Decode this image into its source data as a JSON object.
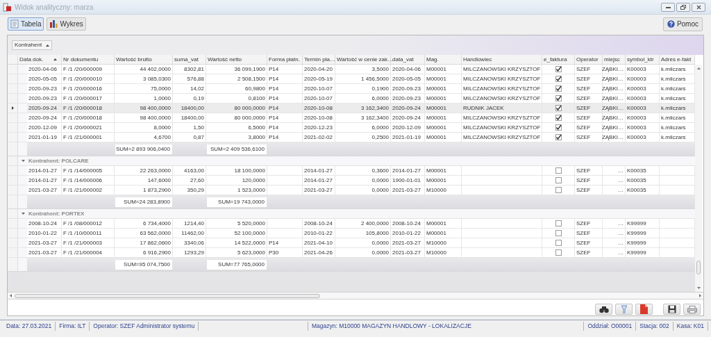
{
  "window": {
    "title": "Widok analityczny: marza"
  },
  "toolbar": {
    "tabs": [
      {
        "label": "Tabela",
        "selected": true,
        "kind": "table"
      },
      {
        "label": "Wykres",
        "selected": false,
        "kind": "chart"
      }
    ],
    "help": "Pomoc"
  },
  "group_panel": {
    "chip": "Kontrahent"
  },
  "columns": [
    {
      "label": "Data dok.",
      "sorted": true
    },
    {
      "label": "Nr dokumentu",
      "sorted": false
    },
    {
      "label": "Wartość brutto",
      "sorted": false
    },
    {
      "label": "suma_vat",
      "sorted": false
    },
    {
      "label": "Wartość netto",
      "sorted": false
    },
    {
      "label": "Forma płatn.",
      "sorted": false
    },
    {
      "label": "Termin pła…",
      "sorted": false
    },
    {
      "label": "Wartość w cenie zak…",
      "sorted": false
    },
    {
      "label": "data_vat",
      "sorted": false
    },
    {
      "label": "Mag.",
      "sorted": false
    },
    {
      "label": "Handlowiec",
      "sorted": false
    },
    {
      "label": "e_faktura",
      "sorted": false
    },
    {
      "label": "Operator",
      "sorted": false
    },
    {
      "label": "miejsc",
      "sorted": false
    },
    {
      "label": "symbol_ktr",
      "sorted": false
    },
    {
      "label": "Adres e-fakt",
      "sorted": false
    }
  ],
  "groups": [
    {
      "rows": [
        {
          "selected": false,
          "date": "2020-04-06",
          "doc": "F /1  /20/000009",
          "gross": "44 402,0000",
          "vat": "8302,81",
          "net": "36 099,1900",
          "payment": "P14",
          "due": "2020-04-20",
          "purchase": "3,5000",
          "vat_date": "2020-04-06",
          "warehouse": "M00001",
          "salesperson": "MILCZANOWSKI KRZYSZTOF",
          "e_invoice": true,
          "operator": "SZEF",
          "place": "ZĄBKI…",
          "symbol": "K00003",
          "email": "k.milczars"
        },
        {
          "selected": false,
          "date": "2020-05-05",
          "doc": "F /1  /20/000010",
          "gross": "3 085,0300",
          "vat": "576,88",
          "net": "2 508,1500",
          "payment": "P14",
          "due": "2020-05-19",
          "purchase": "1 456,5000",
          "vat_date": "2020-05-05",
          "warehouse": "M00001",
          "salesperson": "MILCZANOWSKI KRZYSZTOF",
          "e_invoice": true,
          "operator": "SZEF",
          "place": "ZĄBKI…",
          "symbol": "K00003",
          "email": "k.milczars"
        },
        {
          "selected": false,
          "date": "2020-09-23",
          "doc": "F /1  /20/000016",
          "gross": "75,0000",
          "vat": "14,02",
          "net": "60,9800",
          "payment": "P14",
          "due": "2020-10-07",
          "purchase": "0,1900",
          "vat_date": "2020-09-23",
          "warehouse": "M00001",
          "salesperson": "MILCZANOWSKI KRZYSZTOF",
          "e_invoice": true,
          "operator": "SZEF",
          "place": "ZĄBKI…",
          "symbol": "K00003",
          "email": "k.milczars"
        },
        {
          "selected": false,
          "date": "2020-09-23",
          "doc": "F /1  /20/000017",
          "gross": "1,0000",
          "vat": "0,19",
          "net": "0,8100",
          "payment": "P14",
          "due": "2020-10-07",
          "purchase": "6,0000",
          "vat_date": "2020-09-23",
          "warehouse": "M00001",
          "salesperson": "MILCZANOWSKI KRZYSZTOF",
          "e_invoice": true,
          "operator": "SZEF",
          "place": "ZĄBKI…",
          "symbol": "K00003",
          "email": "k.milczars"
        },
        {
          "selected": true,
          "date": "2020-09-24",
          "doc": "F /1  /20/000018",
          "gross": "98 400,0000",
          "vat": "18400,00",
          "net": "80 000,0000",
          "payment": "P14",
          "due": "2020-10-08",
          "purchase": "3 162,3400",
          "vat_date": "2020-09-24",
          "warehouse": "M00001",
          "salesperson": "RUDNIK JACEK",
          "e_invoice": true,
          "operator": "SZEF",
          "place": "ZĄBKI…",
          "symbol": "K00003",
          "email": "k.milczars"
        },
        {
          "selected": false,
          "date": "2020-09-24",
          "doc": "F /1  /20/000018",
          "gross": "98 400,0000",
          "vat": "18400,00",
          "net": "80 000,0000",
          "payment": "P14",
          "due": "2020-10-08",
          "purchase": "3 162,3400",
          "vat_date": "2020-09-24",
          "warehouse": "M00001",
          "salesperson": "MILCZANOWSKI KRZYSZTOF",
          "e_invoice": true,
          "operator": "SZEF",
          "place": "ZĄBKI…",
          "symbol": "K00003",
          "email": "k.milczars"
        },
        {
          "selected": false,
          "date": "2020-12-09",
          "doc": "F /1  /20/000021",
          "gross": "8,0000",
          "vat": "1,50",
          "net": "6,5000",
          "payment": "P14",
          "due": "2020-12-23",
          "purchase": "6,0000",
          "vat_date": "2020-12-09",
          "warehouse": "M00001",
          "salesperson": "MILCZANOWSKI KRZYSZTOF",
          "e_invoice": true,
          "operator": "SZEF",
          "place": "ZĄBKI…",
          "symbol": "K00003",
          "email": "k.milczars"
        },
        {
          "selected": false,
          "date": "2021-01-19",
          "doc": "F /1  /21/000001",
          "gross": "4,6700",
          "vat": "0,87",
          "net": "3,8000",
          "payment": "P14",
          "due": "2021-02-02",
          "purchase": "0,2500",
          "vat_date": "2021-01-19",
          "warehouse": "M00001",
          "salesperson": "MILCZANOWSKI KRZYSZTOF",
          "e_invoice": true,
          "operator": "SZEF",
          "place": "ZĄBKI…",
          "symbol": "K00003",
          "email": "k.milczars"
        }
      ],
      "sums": {
        "gross": "SUM=2 893 906,0400",
        "net": "SUM=2 409 536,6100"
      }
    },
    {
      "header": "Kontrahent: POLCARE",
      "expanded": true,
      "rows": [
        {
          "selected": false,
          "date": "2014-01-27",
          "doc": "F /1  /14/000005",
          "gross": "22 263,0000",
          "vat": "4163,00",
          "net": "18 100,0000",
          "due": "2014-01-27",
          "purchase": "0,3600",
          "vat_date": "2014-01-27",
          "warehouse": "M00001",
          "e_invoice": false,
          "operator": "SZEF",
          "place": "…",
          "symbol": "K00035"
        },
        {
          "selected": false,
          "date": "2014-01-27",
          "doc": "F /1  /14/000006",
          "gross": "147,6000",
          "vat": "27,60",
          "net": "120,0000",
          "due": "2014-01-27",
          "purchase": "0,0000",
          "vat_date": "1900-01-01",
          "warehouse": "M00001",
          "e_invoice": false,
          "operator": "SZEF",
          "place": "…",
          "symbol": "K00035"
        },
        {
          "selected": false,
          "date": "2021-03-27",
          "doc": "F /1  /21/000002",
          "gross": "1 873,2900",
          "vat": "350,29",
          "net": "1 523,0000",
          "due": "2021-03-27",
          "purchase": "0,0000",
          "vat_date": "2021-03-27",
          "warehouse": "M10000",
          "e_invoice": false,
          "operator": "SZEF",
          "place": "…",
          "symbol": "K00035"
        }
      ],
      "sums": {
        "gross": "SUM=24 283,8900",
        "net": "SUM=19 743,0000"
      }
    },
    {
      "header": "Kontrahent: PORTEX",
      "expanded": true,
      "rows": [
        {
          "selected": false,
          "date": "2008-10-24",
          "doc": "F /1  /08/000012",
          "gross": "6 734,4000",
          "vat": "1214,40",
          "net": "5 520,0000",
          "due": "2008-10-24",
          "purchase": "2 400,0000",
          "vat_date": "2008-10-24",
          "warehouse": "M00001",
          "e_invoice": false,
          "operator": "SZEF",
          "place": "…",
          "symbol": "K99999"
        },
        {
          "selected": false,
          "date": "2010-01-22",
          "doc": "F /1  /10/000011",
          "gross": "63 562,0000",
          "vat": "11462,00",
          "net": "52 100,0000",
          "due": "2010-01-22",
          "purchase": "105,8000",
          "vat_date": "2010-01-22",
          "warehouse": "M00001",
          "e_invoice": false,
          "operator": "SZEF",
          "place": "…",
          "symbol": "K99999"
        },
        {
          "selected": false,
          "date": "2021-03-27",
          "doc": "F /1  /21/000003",
          "gross": "17 862,0600",
          "vat": "3340,06",
          "net": "14 522,0000",
          "payment": "P14",
          "due": "2021-04-10",
          "purchase": "0,0000",
          "vat_date": "2021-03-27",
          "warehouse": "M10000",
          "e_invoice": false,
          "operator": "SZEF",
          "place": "…",
          "symbol": "K99999"
        },
        {
          "selected": false,
          "date": "2021-03-27",
          "doc": "F /1  /21/000004",
          "gross": "6 916,2900",
          "vat": "1293,29",
          "net": "5 623,0000",
          "payment": "P30",
          "due": "2021-04-26",
          "purchase": "0,0000",
          "vat_date": "2021-03-27",
          "warehouse": "M10000",
          "e_invoice": false,
          "operator": "SZEF",
          "place": "…",
          "symbol": "K99999"
        }
      ],
      "sums": {
        "gross": "SUM=95 074,7500",
        "net": "SUM=77 765,0000"
      }
    }
  ],
  "bottom_buttons": [
    {
      "kind": "find"
    },
    {
      "kind": "filter"
    },
    {
      "kind": "pdf"
    },
    {
      "kind": "save"
    },
    {
      "kind": "print"
    }
  ],
  "status_bar": {
    "left": [
      "Data: 27.03.2021",
      "Firma: ILT",
      "Operator: SZEF Administrator systemu"
    ],
    "center": "Magazyn: M10000 MAGAZYN HANDLOWY - LOKALIZACJE",
    "right": [
      "Oddział: O00001",
      "Stacja: 002",
      "Kasa: K01"
    ]
  }
}
